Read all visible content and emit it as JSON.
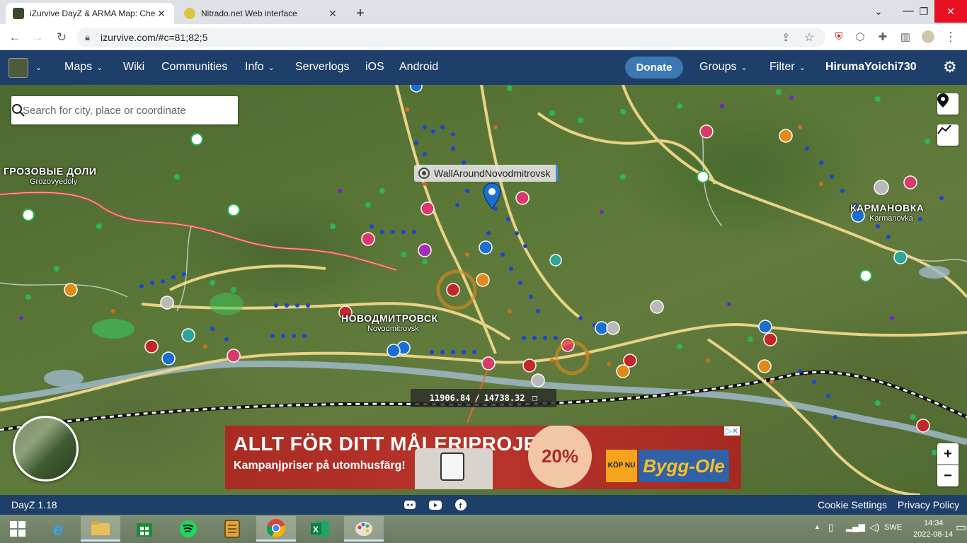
{
  "browser": {
    "tabs": [
      {
        "title": "iZurvive DayZ & ARMA Map: Che",
        "active": true
      },
      {
        "title": "Nitrado.net Web interface",
        "active": false
      }
    ],
    "new_tab_symbol": "+",
    "url": "izurvive.com/#c=81;82;5"
  },
  "appnav": {
    "maps": "Maps",
    "wiki": "Wiki",
    "communities": "Communities",
    "info": "Info",
    "serverlogs": "Serverlogs",
    "ios": "iOS",
    "android": "Android",
    "donate": "Donate",
    "groups": "Groups",
    "filter": "Filter",
    "user": "HirumaYoichi730"
  },
  "search": {
    "placeholder": "Search for city, place or coordinate"
  },
  "places": [
    {
      "ru": "ГРОЗОВЫЕ ДОЛИ",
      "lat": "Grozovyedoly"
    },
    {
      "ru": "НОВОДМИТРОВСК",
      "lat": "Novodmitrovsk"
    },
    {
      "ru": "КАРМАНОВКА",
      "lat": "Karmanovka"
    }
  ],
  "marker": {
    "label": "WallAroundNovodmitrovsk",
    "color": "#1a6fd1"
  },
  "coordinates": {
    "x": "11906.84",
    "separator": "/",
    "y": "14738.32"
  },
  "zoom": {
    "in": "+",
    "out": "−"
  },
  "ad": {
    "headline": "ALLT FÖR DITT MÅLERIPROJEKT",
    "subline": "Kampanjpriser på utomhusfärg!",
    "discount": "20%",
    "kop_nu": "KÖP NU",
    "brand": "Bygg-Ole"
  },
  "footer": {
    "version": "DayZ 1.18",
    "cookie": "Cookie Settings",
    "privacy": "Privacy Policy"
  },
  "taskbar": {
    "apps": [
      "internet-explorer",
      "file-explorer",
      "store",
      "spotify",
      "office-notes",
      "chrome",
      "excel",
      "paint"
    ],
    "language": "SWE",
    "time": "14:34",
    "date": "2022-08-14"
  },
  "colors": {
    "nav_bg": "#1f3f6b",
    "donate_bg": "#3d78b3",
    "marker_blue": "#1a6fd1",
    "ad_red": "#b8342a"
  }
}
